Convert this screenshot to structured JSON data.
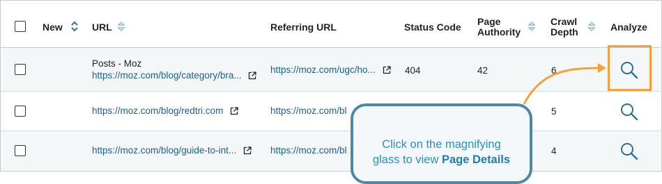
{
  "header": {
    "new": "New",
    "url": "URL",
    "referring_url": "Referring URL",
    "status_code": "Status Code",
    "page_authority_1": "Page",
    "page_authority_2": "Authority",
    "crawl_depth_1": "Crawl",
    "crawl_depth_2": "Depth",
    "analyze": "Analyze"
  },
  "rows": [
    {
      "title": "Posts - Moz",
      "url": "https://moz.com/blog/category/bra...",
      "referring_url": "https://moz.com/ugc/ho...",
      "status_code": "404",
      "page_authority": "42",
      "crawl_depth": "6"
    },
    {
      "title": "",
      "url": "https://moz.com/blog/redtri.com",
      "referring_url": "https://moz.com/bl",
      "status_code": "",
      "page_authority": "",
      "crawl_depth": "5"
    },
    {
      "title": "",
      "url": "https://moz.com/blog/guide-to-int...",
      "referring_url": "https://moz.com/bl",
      "status_code": "",
      "page_authority": "",
      "crawl_depth": "4"
    }
  ],
  "callout": {
    "line1": "Click on the magnifying",
    "line2_prefix": "glass to view ",
    "line2_bold": "Page Details"
  },
  "colors": {
    "accent": "#f5a13a",
    "link": "#1a5e8f",
    "callout_border": "#4d88a4",
    "callout_text": "#2b8fbf"
  },
  "icons": [
    "sort-icon",
    "external-link-icon",
    "magnifier-icon"
  ]
}
